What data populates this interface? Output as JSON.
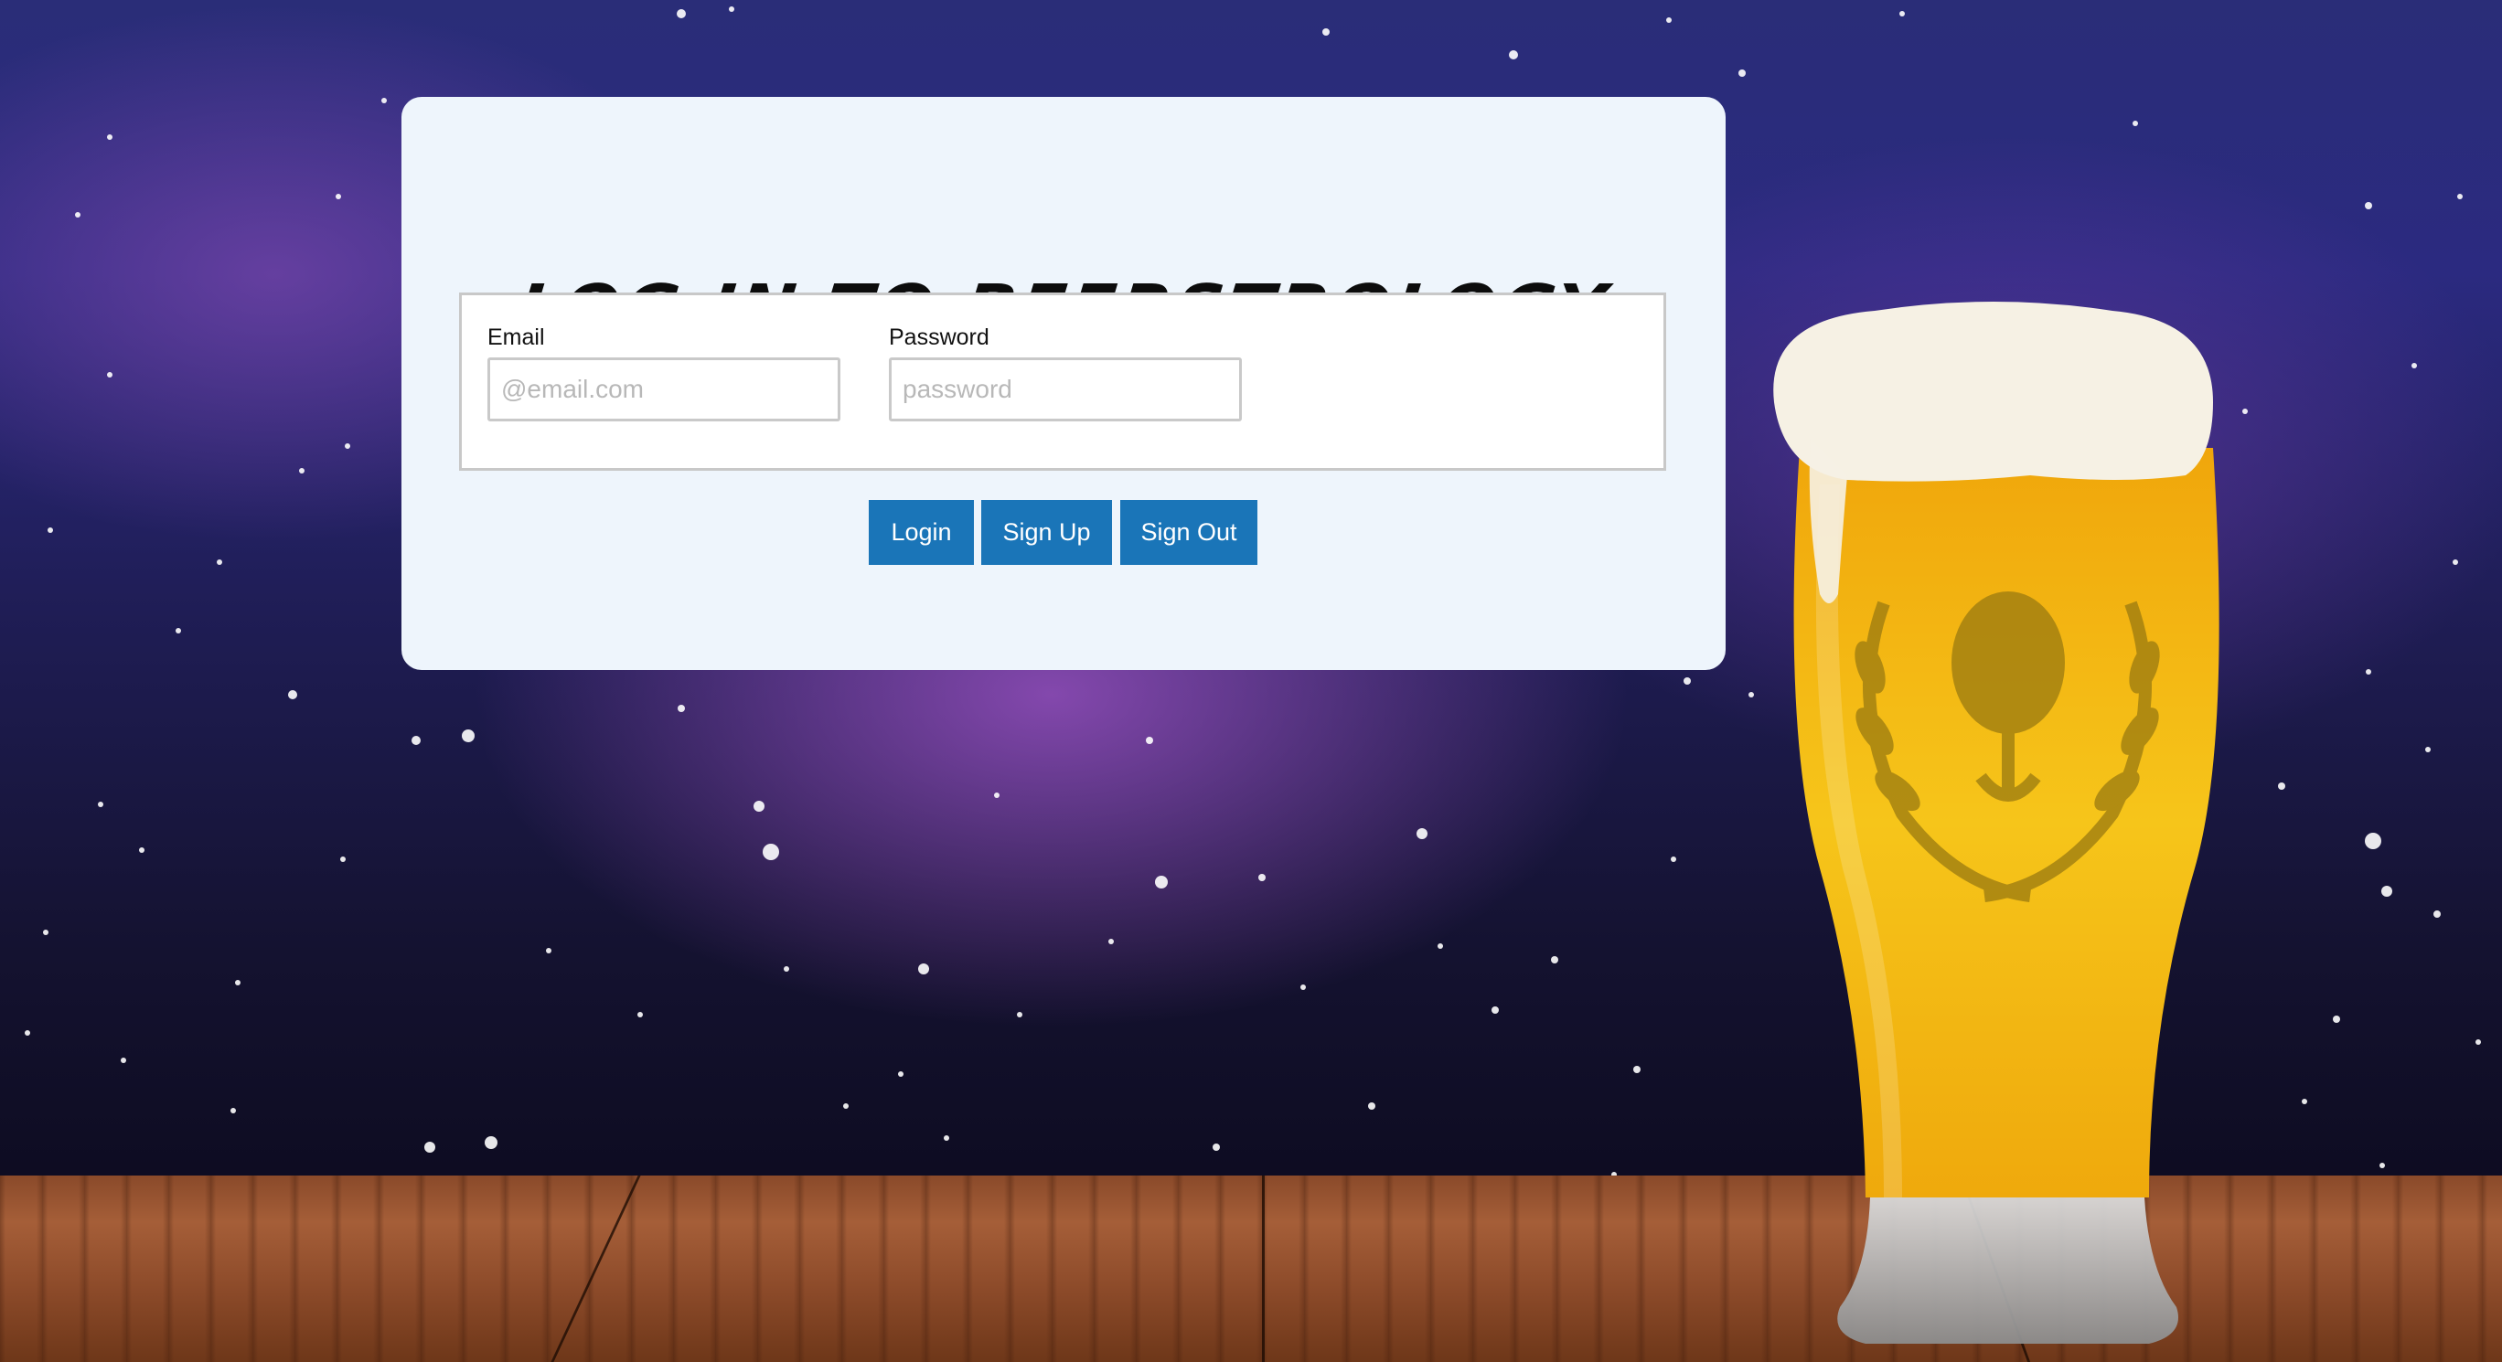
{
  "page": {
    "title": "LOG IN TO BEERSTROLOGY"
  },
  "form": {
    "email_label": "Email",
    "email_placeholder": "@email.com",
    "email_value": "",
    "password_label": "Password",
    "password_placeholder": "password",
    "password_value": ""
  },
  "buttons": {
    "login": "Login",
    "signup": "Sign Up",
    "signout": "Sign Out"
  },
  "colors": {
    "card_background": "#eef5fc",
    "button_background": "#1a75b8",
    "button_text": "#ffffff",
    "beer": "#f2b30c",
    "foam": "#f6f1e4"
  },
  "background": {
    "scene": "night sky with stars over wooden table",
    "decoration": "beer glass with hop logo"
  }
}
